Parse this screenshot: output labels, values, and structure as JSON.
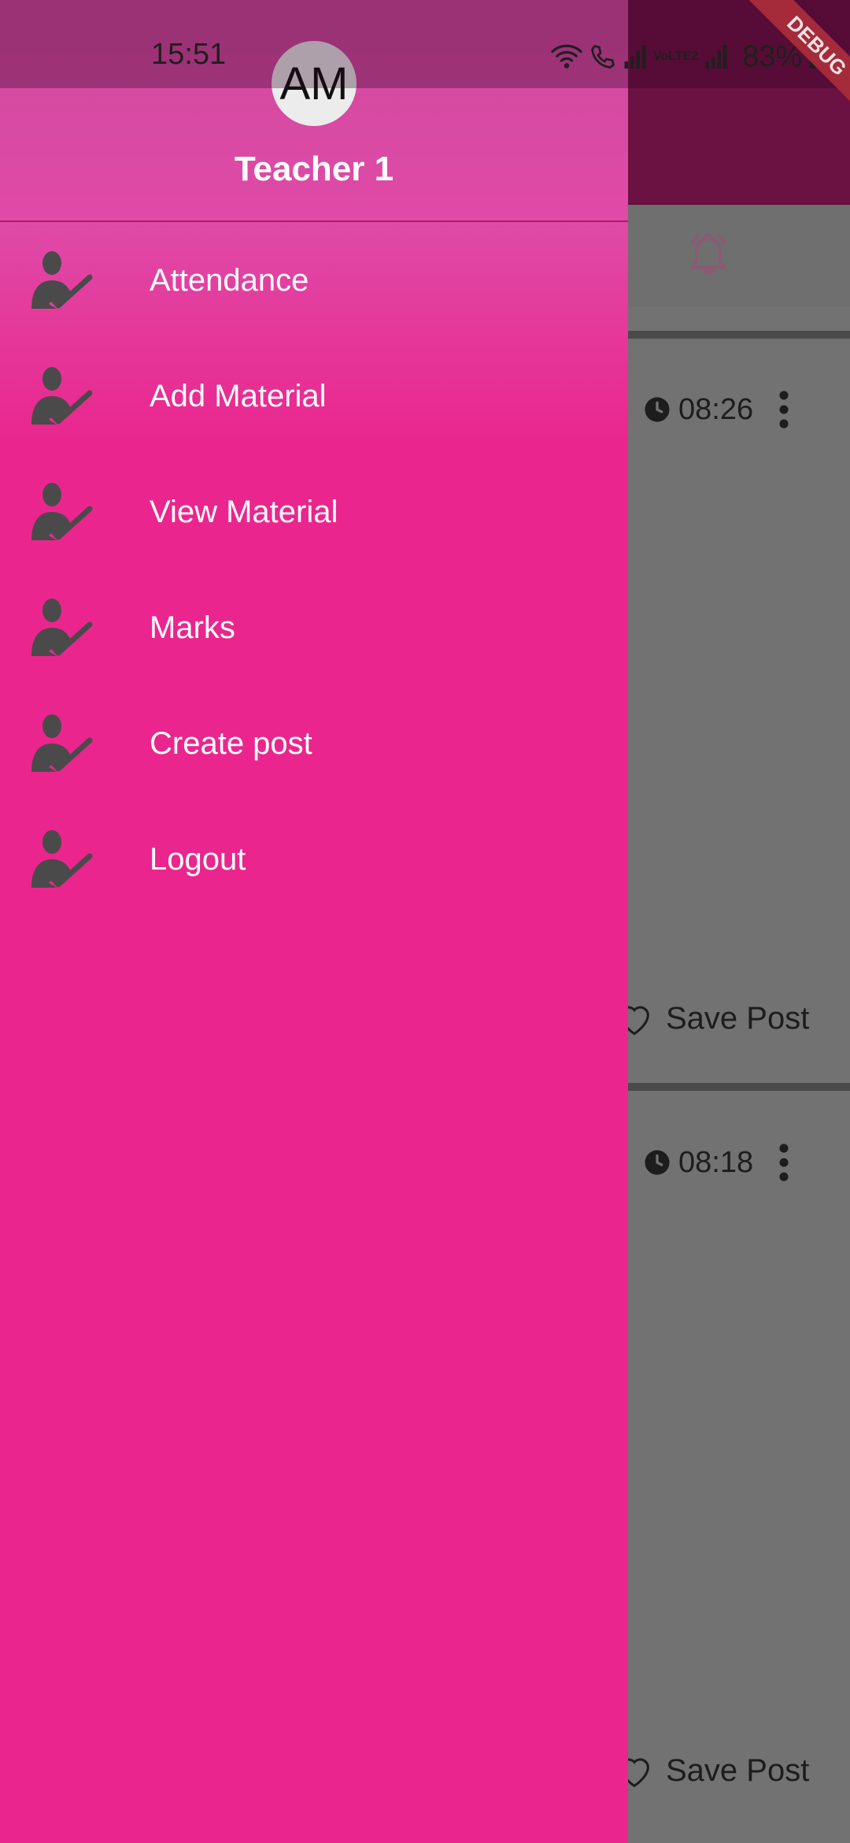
{
  "status_bar": {
    "time": "15:51",
    "battery": "83%",
    "network_label": "VoLTE2",
    "icons": [
      "wifi-icon",
      "call-icon",
      "signal-icon",
      "volte-icon",
      "signal-icon",
      "battery-charging-icon"
    ]
  },
  "debug_banner": "DEBUG",
  "drawer": {
    "avatar_initials": "AM",
    "user_name": "Teacher 1",
    "items": [
      {
        "label": "Attendance",
        "icon": "teacher-check-icon"
      },
      {
        "label": "Add Material",
        "icon": "teacher-check-icon"
      },
      {
        "label": "View Material",
        "icon": "teacher-check-icon"
      },
      {
        "label": "Marks",
        "icon": "teacher-check-icon"
      },
      {
        "label": "Create post",
        "icon": "teacher-check-icon"
      },
      {
        "label": "Logout",
        "icon": "teacher-check-icon"
      }
    ]
  },
  "background": {
    "posts": [
      {
        "time": "08:26",
        "save_label": "Save Post"
      },
      {
        "time": "08:18",
        "save_label": "Save Post"
      }
    ]
  },
  "colors": {
    "drawer": "#ea268e",
    "header": "#d04b9e",
    "app_bar": "#6c1242",
    "content_dimmed": "#727272"
  }
}
